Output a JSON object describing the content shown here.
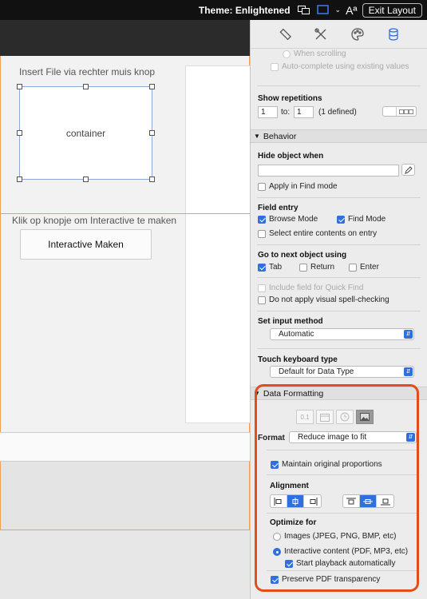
{
  "topbar": {
    "theme_label": "Theme: Enlightened",
    "font_icon_label": "Aª",
    "exit_label": "Exit Layout"
  },
  "canvas": {
    "insert_label": "Insert File via rechter muis knop",
    "container_label": "container",
    "klik_label": "Klik op knopje om Interactive te maken",
    "button_label": "Interactive Maken"
  },
  "inspector": {
    "tabs": [
      "ruler-icon",
      "tools-icon",
      "palette-icon",
      "database-icon"
    ],
    "top_partial": {
      "when_scrolling": "When scrolling",
      "autocomplete": "Auto-complete using existing values"
    },
    "repetitions": {
      "title": "Show repetitions",
      "from": "1",
      "to_label": "to:",
      "to": "1",
      "defined": "(1 defined)"
    },
    "behavior": {
      "header": "Behavior",
      "hide_title": "Hide object when",
      "hide_value": "",
      "apply_find": "Apply in Find mode",
      "field_entry_title": "Field entry",
      "browse_mode": "Browse Mode",
      "find_mode": "Find Mode",
      "select_entire": "Select entire contents on entry",
      "next_object_title": "Go to next object using",
      "tab": "Tab",
      "return": "Return",
      "enter": "Enter",
      "quick_find": "Include field for Quick Find",
      "spell_check": "Do not apply visual spell-checking",
      "input_method_title": "Set input method",
      "input_method_value": "Automatic",
      "touch_title": "Touch keyboard type",
      "touch_value": "Default for Data Type"
    },
    "data_formatting": {
      "header": "Data Formatting",
      "format_buttons": [
        "0.1",
        "calendar-icon",
        "clock-icon",
        "image-icon"
      ],
      "format_label": "Format",
      "format_value": "Reduce image to fit",
      "maintain": "Maintain original proportions",
      "alignment_title": "Alignment",
      "optimize_title": "Optimize for",
      "images_option": "Images (JPEG, PNG, BMP, etc)",
      "interactive_option": "Interactive content (PDF, MP3, etc)",
      "start_playback": "Start playback automatically",
      "preserve_pdf": "Preserve PDF transparency"
    }
  },
  "colors": {
    "accent": "#2f6fe0",
    "highlight": "#e24e1b",
    "part_line": "#f0a050"
  }
}
